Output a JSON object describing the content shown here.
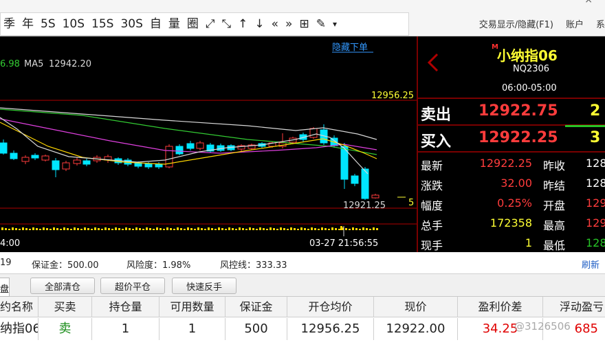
{
  "toolbar": {
    "buttons": [
      "季",
      "年",
      "5S",
      "10S",
      "15S",
      "30S",
      "自",
      "量",
      "圈",
      "⤢",
      "⤡",
      "↑",
      "↓",
      "«",
      "»",
      "⊞",
      "✎",
      "▾"
    ],
    "right_items": [
      "交易显示/隐藏(F1)",
      "账户",
      "系"
    ]
  },
  "chart": {
    "hide_orders_label": "隐藏下单",
    "ma_partial_value": "6.98",
    "ma5_label": "MA5",
    "ma5_value": "12942.20",
    "high_price_label": "12956.25",
    "low_price_label": "12921.25",
    "right_edge_label": "5",
    "time_left": "4:00",
    "time_cursor": "03-27 21:56:55",
    "colors": {
      "up": "#ff3c3c",
      "down": "#00e5ff",
      "ma_white": "#d8d8d8",
      "ma_yellow": "#ffd700",
      "ma_magenta": "#e040e0",
      "ma_green": "#33cc33"
    }
  },
  "quote": {
    "marker": "M",
    "name": "小纳指06",
    "code": "NQ2306",
    "session": "06:00-05:00",
    "sell_label": "卖出",
    "sell_price": "12922.75",
    "sell_qty": "2",
    "buy_label": "买入",
    "buy_price": "12922.25",
    "buy_qty": "3",
    "stats": [
      {
        "label": "最新",
        "value": "12922.25",
        "value_color": "#ff3c3c",
        "label2": "昨收",
        "value2": "128",
        "value2_color": "#ffffff"
      },
      {
        "label": "涨跌",
        "value": "32.00",
        "value_color": "#ff3c3c",
        "label2": "昨结",
        "value2": "128",
        "value2_color": "#ffffff"
      },
      {
        "label": "幅度",
        "value": "0.25%",
        "value_color": "#ff3c3c",
        "label2": "开盘",
        "value2": "129",
        "value2_color": "#ff3c3c"
      },
      {
        "label": "总手",
        "value": "172358",
        "value_color": "#ffff33",
        "label2": "最高",
        "value2": "129",
        "value2_color": "#ff3c3c"
      },
      {
        "label": "现手",
        "value": "1",
        "value_color": "#ffff33",
        "label2": "最低",
        "value2": "128",
        "value2_color": "#27c427"
      }
    ]
  },
  "status": {
    "partial_value": "19",
    "margin_label": "保证金：500.00",
    "risk_label": "风险度：1.98%",
    "control_label": "风控线：333.33",
    "refresh_label": "刷新"
  },
  "buttons": {
    "tab_edge": "盘",
    "close_all": "全部清仓",
    "over_price_close": "超价平仓",
    "quick_reverse": "快速反手"
  },
  "table": {
    "headers": [
      "约名称",
      "买卖",
      "持仓量",
      "可用数量",
      "保证金",
      "开仓均价",
      "现价",
      "盈利价差",
      "浮动盈亏"
    ],
    "row": [
      "纳指06",
      "卖",
      "1",
      "1",
      "500",
      "12956.25",
      "12922.00",
      "34.25",
      "685"
    ],
    "side_color": "#1a8c1a",
    "profit_color": "#e00000"
  },
  "watermark": "@3126506"
}
